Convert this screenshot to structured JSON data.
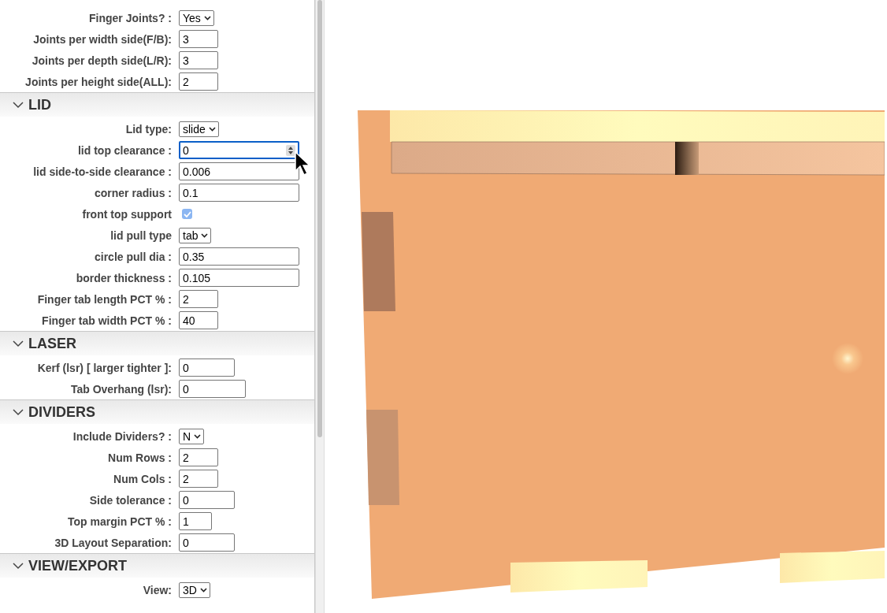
{
  "sections": [
    {
      "fields": [
        {
          "label": "Finger Joints? :",
          "kind": "select",
          "value": "Yes"
        },
        {
          "label": "Joints per width side(F/B):",
          "kind": "shortinput",
          "value": "3"
        },
        {
          "label": "Joints per depth side(L/R):",
          "kind": "shortinput",
          "value": "3"
        },
        {
          "label": "Joints per height side(ALL):",
          "kind": "shortinput",
          "value": "2"
        }
      ]
    },
    {
      "title": "LID",
      "expanded": true,
      "fields": [
        {
          "label": "Lid type:",
          "kind": "select",
          "value": "slide"
        },
        {
          "label": "lid top clearance :",
          "kind": "longinput",
          "value": "0",
          "focused": true
        },
        {
          "label": "lid side-to-side clearance :",
          "kind": "longinput",
          "value": "0.006"
        },
        {
          "label": "corner radius :",
          "kind": "longinput",
          "value": "0.1"
        },
        {
          "label": "front top support",
          "kind": "checkbox",
          "checked": true
        },
        {
          "label": "lid pull type",
          "kind": "select",
          "value": "tab"
        },
        {
          "label": "circle pull dia :",
          "kind": "longinput",
          "value": "0.35"
        },
        {
          "label": "border thickness :",
          "kind": "longinput",
          "value": "0.105"
        },
        {
          "label": "Finger tab length PCT % :",
          "kind": "shortinput",
          "value": "2"
        },
        {
          "label": "Finger tab width PCT % :",
          "kind": "shortinput",
          "value": "40"
        }
      ]
    },
    {
      "title": "LASER",
      "expanded": true,
      "fields": [
        {
          "label": "Kerf (lsr) [ larger tighter ]:",
          "kind": "mediuminput",
          "value": "0"
        },
        {
          "label": "Tab Overhang (lsr):",
          "kind": "wideinput",
          "value": "0"
        }
      ]
    },
    {
      "title": "DIVIDERS",
      "expanded": true,
      "fields": [
        {
          "label": "Include Dividers? :",
          "kind": "select",
          "value": "N"
        },
        {
          "label": "Num Rows :",
          "kind": "shortinput",
          "value": "2"
        },
        {
          "label": "Num Cols :",
          "kind": "shortinput",
          "value": "2"
        },
        {
          "label": "Side tolerance :",
          "kind": "mediuminput",
          "value": "0"
        },
        {
          "label": "Top margin PCT % :",
          "kind": "tinyinput",
          "value": "1"
        },
        {
          "label": "3D Layout Separation:",
          "kind": "mediuminput",
          "value": "0"
        }
      ]
    },
    {
      "title": "VIEW/EXPORT",
      "expanded": true,
      "fields": [
        {
          "label": "View:",
          "kind": "select",
          "value": "3D"
        }
      ]
    }
  ]
}
